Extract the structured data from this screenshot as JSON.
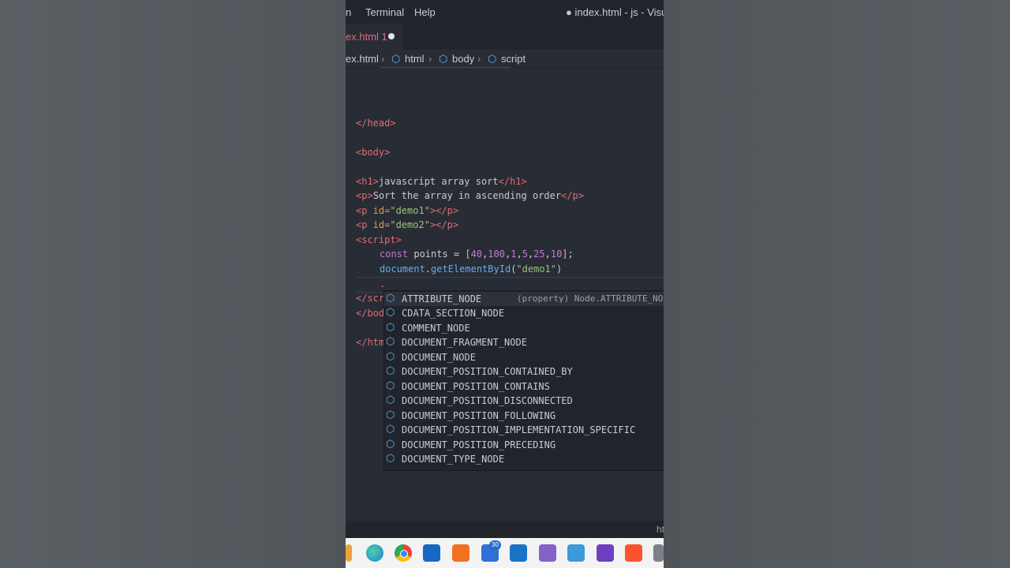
{
  "window": {
    "menu": [
      "n",
      "Terminal",
      "Help"
    ],
    "title": "● index.html - js - Visual"
  },
  "tab": {
    "label": "ex.html 1"
  },
  "breadcrumb": {
    "items": [
      "ex.html",
      "html",
      "body",
      "script"
    ]
  },
  "code": {
    "head_close": "</head>",
    "body_open": "<body>",
    "h1_open": "<h1>",
    "h1_text": "javascript array sort",
    "h1_close": "</h1>",
    "p_open": "<p>",
    "p_text": "Sort the array in ascending order",
    "p_close": "</p>",
    "p1_open": "<p",
    "p1_attr": " id=",
    "p1_val": "\"demo1\"",
    "p1_close": "></p>",
    "p2_open": "<p",
    "p2_attr": " id=",
    "p2_val": "\"demo2\"",
    "p2_close": "></p>",
    "script_open": "<script>",
    "const_kw": "const",
    "const_name": " points = ",
    "array": [
      "40",
      "100",
      "1",
      "5",
      "25",
      "10"
    ],
    "const_end": ";",
    "doc_obj": "document",
    "doc_fn": "getElementById",
    "doc_arg": "\"demo1\"",
    "script_close_partial": "</scr",
    "body_close_partial": "</bod",
    "html_close_partial": "</htm"
  },
  "suggestions": {
    "items": [
      "ATTRIBUTE_NODE",
      "CDATA_SECTION_NODE",
      "COMMENT_NODE",
      "DOCUMENT_FRAGMENT_NODE",
      "DOCUMENT_NODE",
      "DOCUMENT_POSITION_CONTAINED_BY",
      "DOCUMENT_POSITION_CONTAINS",
      "DOCUMENT_POSITION_DISCONNECTED",
      "DOCUMENT_POSITION_FOLLOWING",
      "DOCUMENT_POSITION_IMPLEMENTATION_SPECIFIC",
      "DOCUMENT_POSITION_PRECEDING",
      "DOCUMENT_TYPE_NODE"
    ],
    "detail": "(property) Node.ATTRIBUTE_NODE"
  },
  "statusbar": {
    "right": "ht"
  },
  "taskbar": {
    "mail_badge": "30",
    "icons": [
      "file-icon",
      "edge-icon",
      "chrome-icon",
      "store-icon",
      "xampp-icon",
      "teams-icon",
      "mail-icon",
      "visual-studio-icon",
      "tools-icon",
      "vs-code-icon",
      "brave-icon",
      "settings-icon"
    ]
  },
  "colors": {
    "editor_bg": "#282c34",
    "tag": "#e06c75",
    "string": "#98c379",
    "number": "#c678dd",
    "function": "#61afef"
  }
}
